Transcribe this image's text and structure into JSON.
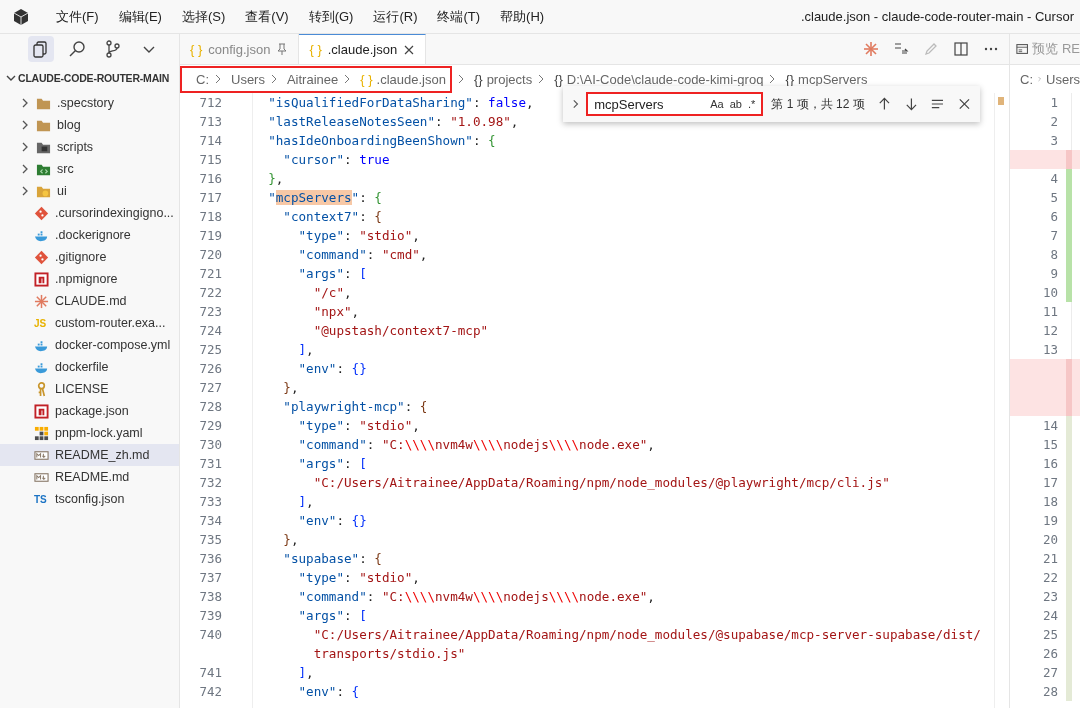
{
  "window": {
    "title": ".claude.json - claude-code-router-main - Cursor"
  },
  "menu": [
    "文件(F)",
    "编辑(E)",
    "选择(S)",
    "查看(V)",
    "转到(G)",
    "运行(R)",
    "终端(T)",
    "帮助(H)"
  ],
  "activity_bar": [
    {
      "kind": "files",
      "selected": true
    },
    {
      "kind": "search",
      "selected": false
    },
    {
      "kind": "source-control",
      "selected": false
    },
    {
      "kind": "more",
      "selected": false
    }
  ],
  "explorer": {
    "title": "CLAUDE-CODE-ROUTER-MAIN",
    "expanded": true,
    "items": [
      {
        "label": ".specstory",
        "kind": "folder",
        "selected": false
      },
      {
        "label": "blog",
        "kind": "folder",
        "selected": false
      },
      {
        "label": "scripts",
        "kind": "folder-scripts",
        "selected": false
      },
      {
        "label": "src",
        "kind": "folder-src",
        "selected": false
      },
      {
        "label": "ui",
        "kind": "folder-ui",
        "selected": false
      },
      {
        "label": ".cursorindexingigno...",
        "kind": "git",
        "selected": false
      },
      {
        "label": ".dockerignore",
        "kind": "docker",
        "selected": false
      },
      {
        "label": ".gitignore",
        "kind": "git",
        "selected": false
      },
      {
        "label": ".npmignore",
        "kind": "npm",
        "selected": false
      },
      {
        "label": "CLAUDE.md",
        "kind": "claude",
        "selected": false
      },
      {
        "label": "custom-router.exa...",
        "kind": "js",
        "badge": "JS",
        "selected": false
      },
      {
        "label": "docker-compose.yml",
        "kind": "docker",
        "selected": false
      },
      {
        "label": "dockerfile",
        "kind": "docker",
        "selected": false
      },
      {
        "label": "LICENSE",
        "kind": "license",
        "selected": false
      },
      {
        "label": "package.json",
        "kind": "npm",
        "selected": false
      },
      {
        "label": "pnpm-lock.yaml",
        "kind": "pnpm",
        "selected": false
      },
      {
        "label": "README_zh.md",
        "kind": "markdown",
        "selected": true
      },
      {
        "label": "README.md",
        "kind": "markdown",
        "selected": false
      },
      {
        "label": "tsconfig.json",
        "kind": "ts",
        "badge": "TS",
        "selected": false
      }
    ]
  },
  "tabs": [
    {
      "icon": "{ }",
      "label": "config.json",
      "pinned": true,
      "selected": false
    },
    {
      "icon": "{ }",
      "label": ".claude.json",
      "pinned": false,
      "selected": true
    }
  ],
  "breadcrumb": [
    {
      "label": "C:",
      "highlighted": true
    },
    {
      "label": "Users",
      "highlighted": true
    },
    {
      "label": "Aitrainee",
      "highlighted": true
    },
    {
      "icon": "{ }",
      "label": ".claude.json",
      "highlighted": true
    },
    {
      "icon": "{}",
      "label": "projects",
      "highlighted": false
    },
    {
      "icon": "{}",
      "label": "D:\\AI-Code\\claude-code-kimi-groq",
      "highlighted": false
    },
    {
      "icon": "{}",
      "label": "mcpServers",
      "highlighted": false
    }
  ],
  "find": {
    "value": "mcpServers",
    "highlighted": true,
    "options": [
      "Aa",
      "ab",
      ".*"
    ],
    "result": "第 1 项，共 12 项"
  },
  "code": [
    {
      "number": "712",
      "tokens": [
        {
          "kind": "key",
          "text": "  \"isQualifiedForDataSharing\""
        },
        {
          "kind": "p",
          "text": ": "
        },
        {
          "kind": "kw",
          "text": "false"
        },
        {
          "kind": "p",
          "text": ","
        }
      ]
    },
    {
      "number": "713",
      "tokens": [
        {
          "kind": "key",
          "text": "  \"lastReleaseNotesSeen\""
        },
        {
          "kind": "p",
          "text": ": "
        },
        {
          "kind": "str",
          "text": "\"1.0.98\""
        },
        {
          "kind": "p",
          "text": ","
        }
      ]
    },
    {
      "number": "714",
      "tokens": [
        {
          "kind": "key",
          "text": "  \"hasIdeOnboardingBeenShown\""
        },
        {
          "kind": "p",
          "text": ": "
        },
        {
          "kind": "b1",
          "text": "{"
        }
      ]
    },
    {
      "number": "715",
      "tokens": [
        {
          "kind": "key",
          "text": "    \"cursor\""
        },
        {
          "kind": "p",
          "text": ": "
        },
        {
          "kind": "kw",
          "text": "true"
        }
      ]
    },
    {
      "number": "716",
      "tokens": [
        {
          "kind": "b1",
          "text": "  }"
        },
        {
          "kind": "p",
          "text": ","
        }
      ]
    },
    {
      "number": "717",
      "tokens": [
        {
          "kind": "key",
          "text": "  \""
        },
        {
          "kind": "match",
          "text": "mcpServers"
        },
        {
          "kind": "key",
          "text": "\""
        },
        {
          "kind": "p",
          "text": ": "
        },
        {
          "kind": "b1",
          "text": "{"
        }
      ]
    },
    {
      "number": "718",
      "tokens": [
        {
          "kind": "key",
          "text": "    \"context7\""
        },
        {
          "kind": "p",
          "text": ": "
        },
        {
          "kind": "b2",
          "text": "{"
        }
      ]
    },
    {
      "number": "719",
      "tokens": [
        {
          "kind": "key",
          "text": "      \"type\""
        },
        {
          "kind": "p",
          "text": ": "
        },
        {
          "kind": "str",
          "text": "\"stdio\""
        },
        {
          "kind": "p",
          "text": ","
        }
      ]
    },
    {
      "number": "720",
      "tokens": [
        {
          "kind": "key",
          "text": "      \"command\""
        },
        {
          "kind": "p",
          "text": ": "
        },
        {
          "kind": "str",
          "text": "\"cmd\""
        },
        {
          "kind": "p",
          "text": ","
        }
      ]
    },
    {
      "number": "721",
      "tokens": [
        {
          "kind": "key",
          "text": "      \"args\""
        },
        {
          "kind": "p",
          "text": ": "
        },
        {
          "kind": "b3",
          "text": "["
        }
      ]
    },
    {
      "number": "722",
      "tokens": [
        {
          "kind": "str",
          "text": "        \"/c\""
        },
        {
          "kind": "p",
          "text": ","
        }
      ]
    },
    {
      "number": "723",
      "tokens": [
        {
          "kind": "str",
          "text": "        \"npx\""
        },
        {
          "kind": "p",
          "text": ","
        }
      ]
    },
    {
      "number": "724",
      "tokens": [
        {
          "kind": "str",
          "text": "        \"@upstash/context7-mcp\""
        }
      ]
    },
    {
      "number": "725",
      "tokens": [
        {
          "kind": "b3",
          "text": "      ]"
        },
        {
          "kind": "p",
          "text": ","
        }
      ]
    },
    {
      "number": "726",
      "tokens": [
        {
          "kind": "key",
          "text": "      \"env\""
        },
        {
          "kind": "p",
          "text": ": "
        },
        {
          "kind": "b3",
          "text": "{}"
        }
      ]
    },
    {
      "number": "727",
      "tokens": [
        {
          "kind": "b2",
          "text": "    }"
        },
        {
          "kind": "p",
          "text": ","
        }
      ]
    },
    {
      "number": "728",
      "tokens": [
        {
          "kind": "key",
          "text": "    \"playwright-mcp\""
        },
        {
          "kind": "p",
          "text": ": "
        },
        {
          "kind": "b2",
          "text": "{"
        }
      ]
    },
    {
      "number": "729",
      "tokens": [
        {
          "kind": "key",
          "text": "      \"type\""
        },
        {
          "kind": "p",
          "text": ": "
        },
        {
          "kind": "str",
          "text": "\"stdio\""
        },
        {
          "kind": "p",
          "text": ","
        }
      ]
    },
    {
      "number": "730",
      "tokens": [
        {
          "kind": "key",
          "text": "      \"command\""
        },
        {
          "kind": "p",
          "text": ": "
        },
        {
          "kind": "str",
          "text": "\"C:"
        },
        {
          "kind": "esc",
          "text": "\\\\\\\\"
        },
        {
          "kind": "str",
          "text": "nvm4w"
        },
        {
          "kind": "esc",
          "text": "\\\\\\\\"
        },
        {
          "kind": "str",
          "text": "nodejs"
        },
        {
          "kind": "esc",
          "text": "\\\\\\\\"
        },
        {
          "kind": "str",
          "text": "node.exe\""
        },
        {
          "kind": "p",
          "text": ","
        }
      ]
    },
    {
      "number": "731",
      "tokens": [
        {
          "kind": "key",
          "text": "      \"args\""
        },
        {
          "kind": "p",
          "text": ": "
        },
        {
          "kind": "b3",
          "text": "["
        }
      ]
    },
    {
      "number": "732",
      "tokens": [
        {
          "kind": "str",
          "text": "        \"C:/Users/Aitrainee/AppData/Roaming/npm/node_modules/@playwright/mcp/cli.js\""
        }
      ]
    },
    {
      "number": "733",
      "tokens": [
        {
          "kind": "b3",
          "text": "      ]"
        },
        {
          "kind": "p",
          "text": ","
        }
      ]
    },
    {
      "number": "734",
      "tokens": [
        {
          "kind": "key",
          "text": "      \"env\""
        },
        {
          "kind": "p",
          "text": ": "
        },
        {
          "kind": "b3",
          "text": "{}"
        }
      ]
    },
    {
      "number": "735",
      "tokens": [
        {
          "kind": "b2",
          "text": "    }"
        },
        {
          "kind": "p",
          "text": ","
        }
      ]
    },
    {
      "number": "736",
      "tokens": [
        {
          "kind": "key",
          "text": "    \"supabase\""
        },
        {
          "kind": "p",
          "text": ": "
        },
        {
          "kind": "b2",
          "text": "{"
        }
      ]
    },
    {
      "number": "737",
      "tokens": [
        {
          "kind": "key",
          "text": "      \"type\""
        },
        {
          "kind": "p",
          "text": ": "
        },
        {
          "kind": "str",
          "text": "\"stdio\""
        },
        {
          "kind": "p",
          "text": ","
        }
      ]
    },
    {
      "number": "738",
      "tokens": [
        {
          "kind": "key",
          "text": "      \"command\""
        },
        {
          "kind": "p",
          "text": ": "
        },
        {
          "kind": "str",
          "text": "\"C:"
        },
        {
          "kind": "esc",
          "text": "\\\\\\\\"
        },
        {
          "kind": "str",
          "text": "nvm4w"
        },
        {
          "kind": "esc",
          "text": "\\\\\\\\"
        },
        {
          "kind": "str",
          "text": "nodejs"
        },
        {
          "kind": "esc",
          "text": "\\\\\\\\"
        },
        {
          "kind": "str",
          "text": "node.exe\""
        },
        {
          "kind": "p",
          "text": ","
        }
      ]
    },
    {
      "number": "739",
      "tokens": [
        {
          "kind": "key",
          "text": "      \"args\""
        },
        {
          "kind": "p",
          "text": ": "
        },
        {
          "kind": "b3",
          "text": "["
        }
      ]
    },
    {
      "number": "740",
      "tokens": [
        {
          "kind": "str",
          "text": "        \"C:/Users/Aitrainee/AppData/Roaming/npm/node_modules/@supabase/mcp-server-supabase/dist/"
        }
      ]
    },
    {
      "tokens": [
        {
          "kind": "str",
          "text": "        transports/stdio.js\""
        }
      ]
    },
    {
      "number": "741",
      "tokens": [
        {
          "kind": "b3",
          "text": "      ]"
        },
        {
          "kind": "p",
          "text": ","
        }
      ]
    },
    {
      "number": "742",
      "tokens": [
        {
          "kind": "key",
          "text": "      \"env\""
        },
        {
          "kind": "p",
          "text": ": "
        },
        {
          "kind": "b3",
          "text": "{"
        }
      ]
    }
  ],
  "preview": {
    "title": "预览 RE",
    "breadcrumb": [
      "C:",
      "Users"
    ],
    "lines": [
      {
        "number": "1",
        "kind": "none"
      },
      {
        "number": "2",
        "kind": "none"
      },
      {
        "number": "3",
        "kind": "none"
      },
      {
        "kind": "deleted"
      },
      {
        "number": "4",
        "kind": "added"
      },
      {
        "number": "5",
        "kind": "added"
      },
      {
        "number": "6",
        "kind": "added"
      },
      {
        "number": "7",
        "kind": "added"
      },
      {
        "number": "8",
        "kind": "added"
      },
      {
        "number": "9",
        "kind": "added"
      },
      {
        "number": "10",
        "kind": "added"
      },
      {
        "number": "11",
        "kind": "none"
      },
      {
        "number": "12",
        "kind": "none"
      },
      {
        "number": "13",
        "kind": "none"
      },
      {
        "kind": "deleted"
      },
      {
        "kind": "deleted"
      },
      {
        "kind": "deleted"
      },
      {
        "number": "14",
        "kind": "modified"
      },
      {
        "number": "15",
        "kind": "modified"
      },
      {
        "number": "16",
        "kind": "modified"
      },
      {
        "number": "17",
        "kind": "modified"
      },
      {
        "number": "18",
        "kind": "modified"
      },
      {
        "number": "19",
        "kind": "modified"
      },
      {
        "number": "20",
        "kind": "modified"
      },
      {
        "number": "21",
        "kind": "modified"
      },
      {
        "number": "22",
        "kind": "modified"
      },
      {
        "number": "23",
        "kind": "modified"
      },
      {
        "number": "24",
        "kind": "modified"
      },
      {
        "number": "25",
        "kind": "modified"
      },
      {
        "number": "26",
        "kind": "modified"
      },
      {
        "number": "27",
        "kind": "modified"
      },
      {
        "number": "28",
        "kind": "modified"
      }
    ]
  }
}
